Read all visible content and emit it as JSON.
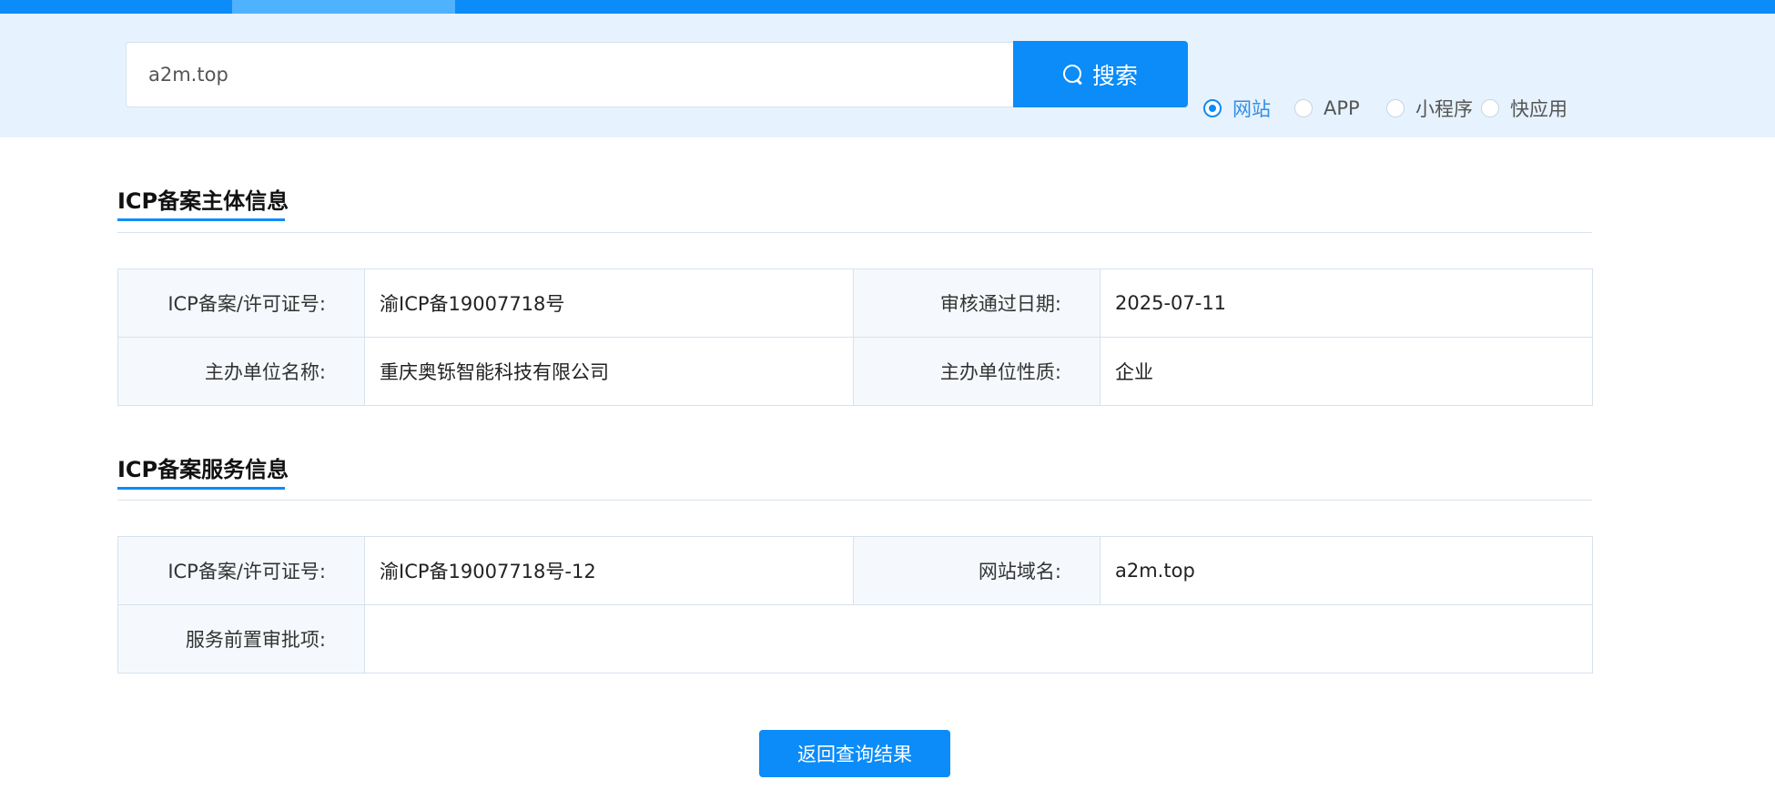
{
  "search": {
    "query": "a2m.top",
    "button_label": "搜索",
    "type_options": [
      {
        "label": "网站",
        "selected": true
      },
      {
        "label": "APP",
        "selected": false
      },
      {
        "label": "小程序",
        "selected": false
      },
      {
        "label": "快应用",
        "selected": false
      }
    ]
  },
  "subject_section": {
    "title": "ICP备案主体信息",
    "rows": [
      {
        "label1": "ICP备案/许可证号:",
        "value1": "渝ICP备19007718号",
        "label2": "审核通过日期:",
        "value2": "2025-07-11"
      },
      {
        "label1": "主办单位名称:",
        "value1": "重庆奥铄智能科技有限公司",
        "label2": "主办单位性质:",
        "value2": "企业"
      }
    ]
  },
  "service_section": {
    "title": "ICP备案服务信息",
    "license_label": "ICP备案/许可证号:",
    "license_value": "渝ICP备19007718号-12",
    "domain_label": "网站域名:",
    "domain_value": "a2m.top",
    "approval_label": "服务前置审批项:",
    "approval_value": ""
  },
  "back_button_label": "返回查询结果",
  "colors": {
    "accent": "#0b8cf8",
    "band": "#e6f2fd",
    "label_bg": "#f5f9fd",
    "border": "#d6e2ee"
  }
}
